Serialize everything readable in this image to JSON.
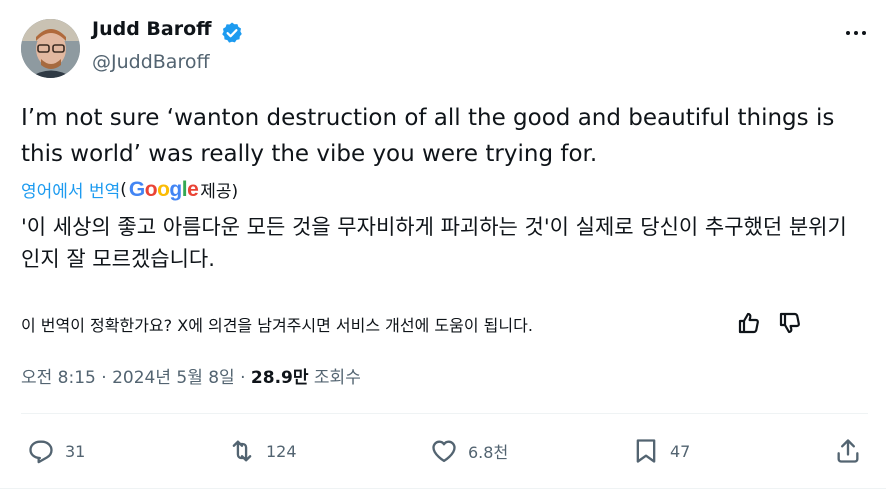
{
  "author": {
    "name": "Judd Baroff",
    "handle": "@JuddBaroff"
  },
  "tweet": {
    "text": "I’m not sure ‘wanton destruction of all the good and beautiful things is this world’ was really the vibe you were trying for."
  },
  "translation": {
    "link_label": "영어에서 번역",
    "paren_open": "(",
    "provider": "Google",
    "provider_suffix": "제공)",
    "text": "'이 세상의 좋고 아름다운 모든 것을 무자비하게 파괴하는 것'이 실제로 당신이 추구했던 분위기인지 잘 모르겠습니다.",
    "feedback_prompt": "이 번역이 정확한가요? X에 의견을 남겨주시면 서비스 개선에 도움이 됩니다."
  },
  "meta": {
    "time": "오전 8:15",
    "date": "2024년 5월 8일",
    "separator": "·",
    "views_count": "28.9만",
    "views_label": "조회수"
  },
  "actions": {
    "replies": "31",
    "reposts": "124",
    "likes": "6.8천",
    "bookmarks": "47"
  },
  "colors": {
    "accent": "#1d9bf0",
    "muted": "#536471",
    "text": "#0f1419",
    "google_blue": "#4285f4",
    "google_red": "#ea4335",
    "google_yellow": "#fbbc05",
    "google_green": "#34a853"
  },
  "icons": [
    "verified-badge-icon",
    "more-options-icon",
    "thumbs-up-icon",
    "thumbs-down-icon",
    "reply-icon",
    "repost-icon",
    "like-icon",
    "bookmark-icon",
    "share-icon"
  ]
}
